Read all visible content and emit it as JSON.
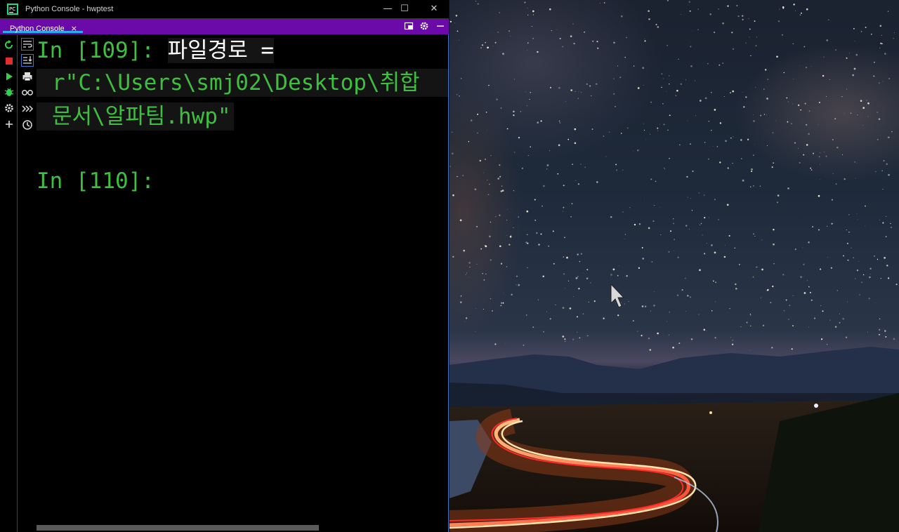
{
  "window": {
    "title": "Python Console - hwptest",
    "minimize": "—",
    "maximize": "☐",
    "close": "✕"
  },
  "tabs": [
    {
      "label": "Python Console",
      "close": "×",
      "active": true
    }
  ],
  "tab_actions": [
    "restore-layout-icon",
    "gear-icon",
    "minimize-icon"
  ],
  "left_toolbar": [
    "rerun-icon",
    "stop-icon",
    "run-icon",
    "debug-icon",
    "settings-icon",
    "add-icon"
  ],
  "sub_toolbar": [
    "soft-wrap-icon",
    "scroll-to-end-icon",
    "print-icon",
    "variables-view-icon",
    "execute-icon",
    "history-icon"
  ],
  "console": {
    "line1_prompt": "In [109]: ",
    "line1_ident": "파일경로",
    "line1_rest": " =",
    "line2": "r\"C:\\Users\\smj02\\Desktop\\취합",
    "line3": "문서\\알파팀.hwp\"",
    "line4_prompt": "In [110]:"
  },
  "colors": {
    "prompt": "#3fbf3f",
    "tab_bar": "#6b0aa8",
    "tab_underline": "#25b0e8",
    "window_border": "#3a79d0"
  }
}
